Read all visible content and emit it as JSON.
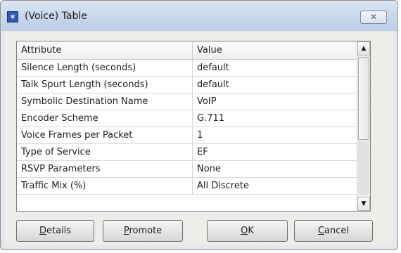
{
  "window": {
    "title": "(Voice) Table",
    "close_glyph": "✕",
    "icon": "app-star-icon"
  },
  "table": {
    "headers": {
      "attribute": "Attribute",
      "value": "Value"
    },
    "rows": [
      {
        "attribute": "Silence Length (seconds)",
        "value": "default"
      },
      {
        "attribute": "Talk Spurt Length (seconds)",
        "value": "default"
      },
      {
        "attribute": "Symbolic Destination Name",
        "value": "VoIP"
      },
      {
        "attribute": "Encoder Scheme",
        "value": "G.711"
      },
      {
        "attribute": "Voice Frames per Packet",
        "value": "1"
      },
      {
        "attribute": "Type of Service",
        "value": "EF"
      },
      {
        "attribute": "RSVP Parameters",
        "value": "None"
      },
      {
        "attribute": "Traffic Mix (%)",
        "value": "All Discrete"
      }
    ]
  },
  "buttons": {
    "details": {
      "mnemonic": "D",
      "rest": "etails"
    },
    "promote": {
      "mnemonic": "P",
      "rest": "romote"
    },
    "ok": {
      "mnemonic": "O",
      "rest": "K"
    },
    "cancel": {
      "mnemonic": "C",
      "rest": "ancel"
    }
  }
}
